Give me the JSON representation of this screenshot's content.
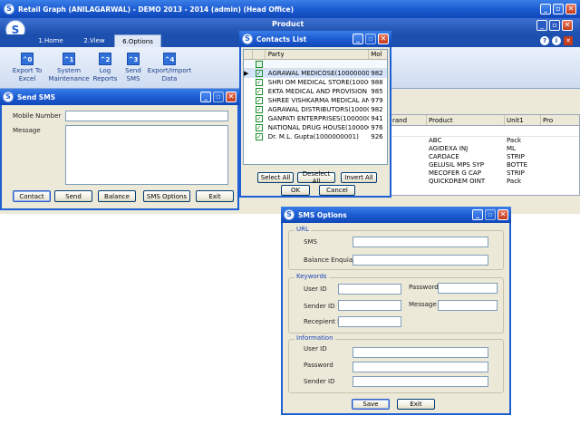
{
  "main_window": {
    "title": "Retail Graph (ANILAGARWAL) - DEMO  2013 - 2014 (admin) (Head Office)",
    "sub_title": "Product",
    "menu_tabs": [
      {
        "label": "1.Home"
      },
      {
        "label": "2.View"
      },
      {
        "label": "6.Options"
      }
    ],
    "toolbar": [
      {
        "key": "^0",
        "label": "Export To Excel"
      },
      {
        "key": "^1",
        "label": "System Maintenance"
      },
      {
        "key": "^2",
        "label": "Log Reports"
      },
      {
        "key": "^3",
        "label": "Send SMS"
      },
      {
        "key": "^4",
        "label": "Export/Import Data"
      }
    ]
  },
  "product_grid": {
    "headers": [
      "rand",
      "Product",
      "Unit1",
      "Pro"
    ],
    "rows": [
      {
        "product": "ABC",
        "unit": "Pack"
      },
      {
        "product": "AGIDEXA INJ",
        "unit": "ML"
      },
      {
        "product": "CARDACE",
        "unit": "STRIP"
      },
      {
        "product": "GELUSIL MPS SYP",
        "unit": "BOTTE"
      },
      {
        "product": "MECOFER G CAP",
        "unit": "STRIP"
      },
      {
        "product": "QUICKDREM OINT",
        "unit": "Pack"
      }
    ]
  },
  "send_sms": {
    "title": "Send SMS",
    "mobile_label": "Mobile Number",
    "message_label": "Message",
    "buttons": {
      "contact": "Contact",
      "send": "Send",
      "balance": "Balance",
      "options": "SMS Options",
      "exit": "Exit"
    }
  },
  "contacts_list": {
    "title": "Contacts List",
    "headers": {
      "party": "Party",
      "mobile": "Mol"
    },
    "rows": [
      {
        "party": "AGRAWAL MEDICOSE(10000000000",
        "mobile": "982"
      },
      {
        "party": "SHRI OM MEDICAL STORE(1000000",
        "mobile": "988"
      },
      {
        "party": "EKTA MEDICAL AND PROVISION ST",
        "mobile": "985"
      },
      {
        "party": "SHREE VISHKARMA MEDICAL AND",
        "mobile": "979"
      },
      {
        "party": "AGRAWAL DISTRIBUTORS(1000000",
        "mobile": "982"
      },
      {
        "party": "GANPATI ENTERPRISES(100000000",
        "mobile": "941"
      },
      {
        "party": "NATIONAL DRUG HOUSE(10000000",
        "mobile": "976"
      },
      {
        "party": "Dr. M.L. Gupta(1000000001)",
        "mobile": "926"
      }
    ],
    "buttons": {
      "select_all": "Select All",
      "deselect_all": "Deselect All",
      "invert_all": "Invert All",
      "ok": "OK",
      "cancel": "Cancel"
    }
  },
  "sms_options": {
    "title": "SMS Options",
    "url_group": {
      "title": "URL",
      "sms_label": "SMS",
      "balance_label": "Balance Enquiary"
    },
    "keywords_group": {
      "title": "Keywords",
      "user_id_label": "User ID",
      "password_label": "Password",
      "sender_id_label": "Sender ID",
      "message_label": "Message",
      "recipient_label": "Recepient No"
    },
    "info_group": {
      "title": "Information",
      "user_id_label": "User ID",
      "password_label": "Password",
      "sender_id_label": "Sender ID"
    },
    "buttons": {
      "save": "Save",
      "exit": "Exit"
    }
  },
  "colors": {
    "title_blue": "#1f5fd4",
    "ribbon_blue": "#1d4fae",
    "selected_row": "#b6cdf2",
    "checkbox_green": "#1d8f2e"
  }
}
